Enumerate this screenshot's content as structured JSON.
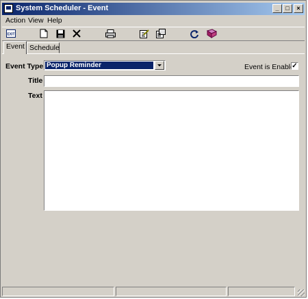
{
  "window": {
    "title": "System Scheduler - Event"
  },
  "menu": [
    "Action",
    "View",
    "Help"
  ],
  "toolbar": {
    "exit_label": "EXIT",
    "icons": [
      "exit-icon",
      "new-icon",
      "save-icon",
      "delete-icon",
      "print-icon",
      "edit-icon",
      "properties-icon",
      "refresh-icon",
      "help-book-icon"
    ]
  },
  "tabs": [
    {
      "label": "Event",
      "active": true
    },
    {
      "label": "Schedule",
      "active": false
    }
  ],
  "form": {
    "event_type_label": "Event Type",
    "event_type_value": "Popup Reminder",
    "enabled_label": "Event is Enabled",
    "enabled_checked": true,
    "title_label": "Title",
    "title_value": "",
    "text_label": "Text",
    "text_value": ""
  },
  "colors": {
    "titlebar_start": "#0a246a",
    "titlebar_end": "#a6caf0",
    "face": "#d4d0c8",
    "selection": "#0a246a"
  }
}
